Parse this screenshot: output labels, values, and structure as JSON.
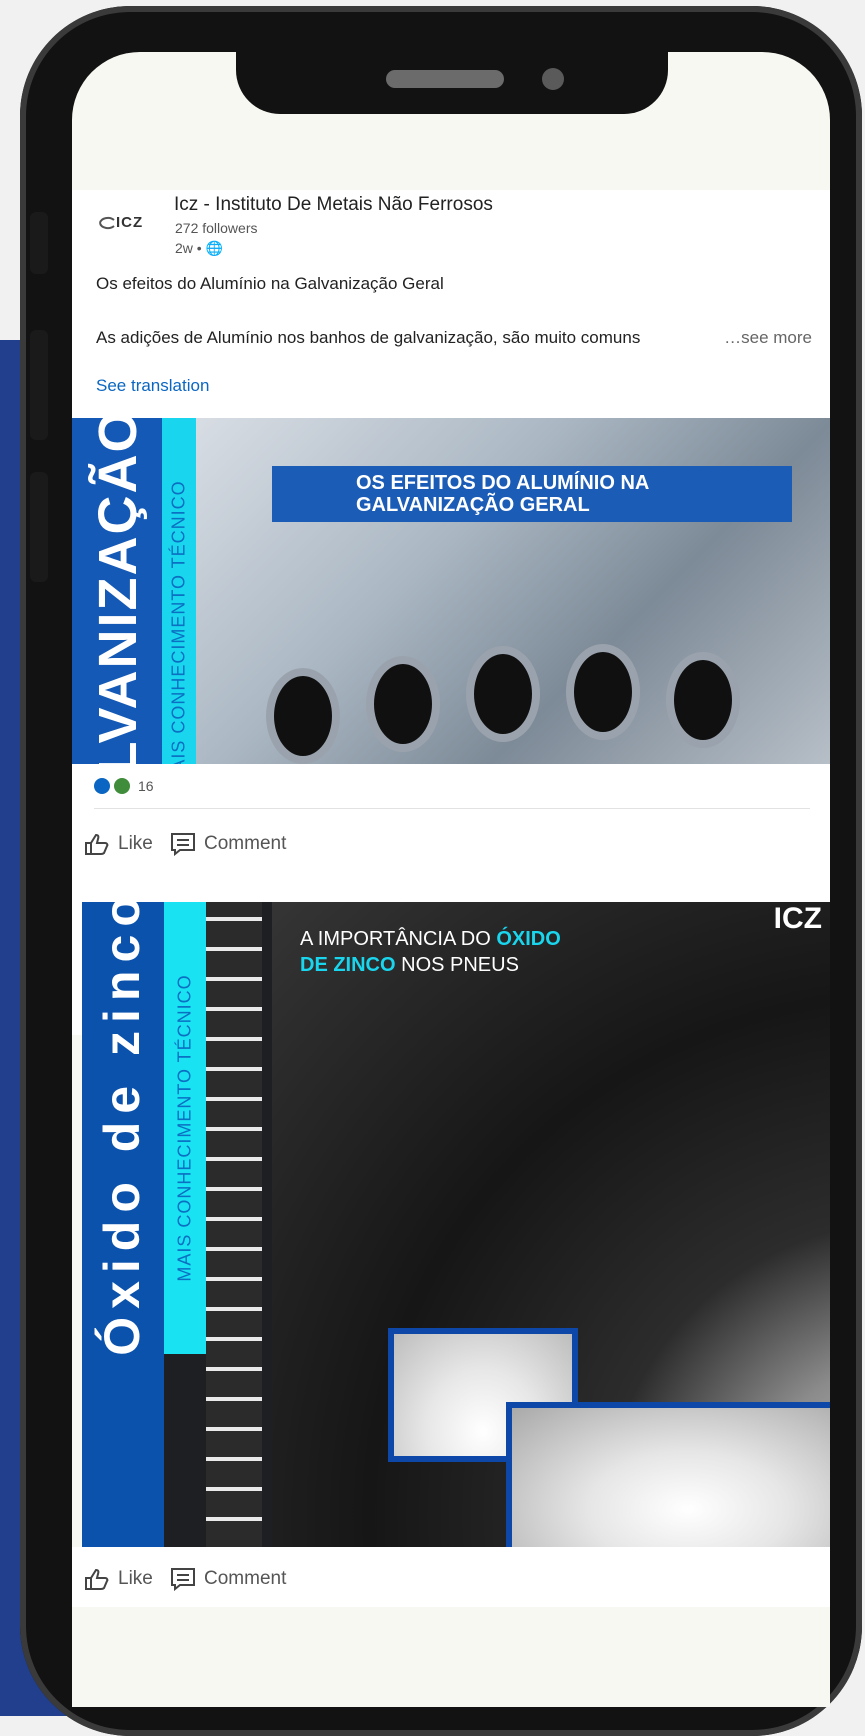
{
  "post": {
    "company": "Icz - Instituto De Metais Não Ferrosos",
    "logo_text": "ICZ",
    "followers": "272 followers",
    "time": "2w • 🌐",
    "line1": "Os efeitos do Alumínio na Galvanização Geral",
    "line2": "As adições de Alumínio nos banhos de galvanização, são muito comuns",
    "see_more": "…see more",
    "see_translation": "See translation"
  },
  "image1": {
    "vertical_title": "GALVANIZAÇÃO",
    "vertical_sub": "MAIS CONHECIMENTO TÉCNICO",
    "banner_line1": "OS EFEITOS DO ALUMÍNIO NA",
    "banner_line2": "GALVANIZAÇÃO GERAL"
  },
  "reactions": {
    "count": "16"
  },
  "actions": {
    "like": "Like",
    "comment": "Comment"
  },
  "image2": {
    "vertical_title": "Óxido de zinco",
    "vertical_sub": "MAIS CONHECIMENTO TÉCNICO",
    "title_a": "A IMPORTÂNCIA DO ",
    "title_b": "ÓXIDO",
    "title_c": "DE ZINCO",
    "title_d": " NOS PNEUS",
    "logo": "ICZ"
  },
  "colors": {
    "accent": "#0a66c2",
    "brand_blue": "#1459b5",
    "cyan": "#19d6ee",
    "page_blue": "#223f8d"
  }
}
